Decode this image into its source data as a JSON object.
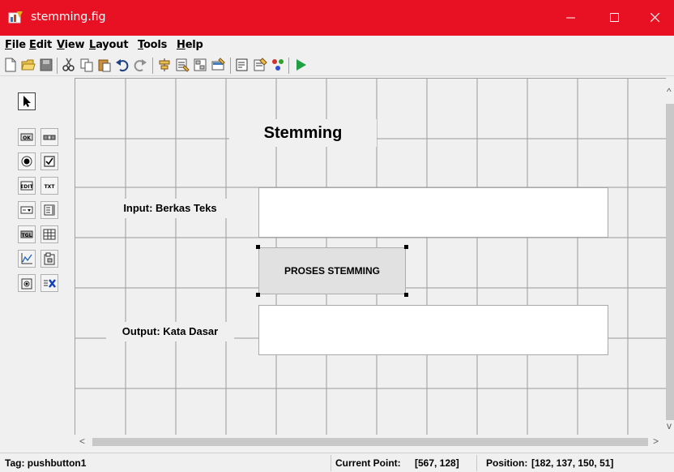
{
  "window": {
    "title": "stemming.fig",
    "accent_color": "#e81123",
    "icons": [
      "app-figure-icon",
      "minimize-icon",
      "maximize-icon",
      "close-icon"
    ]
  },
  "menu": [
    {
      "accel": "F",
      "rest": "ile"
    },
    {
      "accel": "E",
      "rest": "dit"
    },
    {
      "accel": "V",
      "rest": "iew"
    },
    {
      "accel": "L",
      "rest": "ayout"
    },
    {
      "accel": "T",
      "rest": "ools"
    },
    {
      "accel": "H",
      "rest": "elp"
    }
  ],
  "toolbar_icons": [
    "new-icon",
    "open-icon",
    "save-icon",
    "cut-icon",
    "copy-icon",
    "paste-icon",
    "undo-icon",
    "redo-icon",
    "align-icon",
    "menu-editor-icon",
    "tab-order-icon",
    "toolbar-editor-icon",
    "editor-icon",
    "property-inspector-icon",
    "object-browser-icon",
    "run-icon"
  ],
  "palette_icons": [
    "select-arrow-icon",
    "push-button-icon",
    "slider-icon",
    "radio-button-icon",
    "checkbox-icon",
    "edit-text-icon",
    "static-text-icon",
    "popup-menu-icon",
    "listbox-icon",
    "toggle-button-icon",
    "table-icon",
    "axes-icon",
    "panel-icon",
    "button-group-icon",
    "activex-icon"
  ],
  "figure": {
    "heading": "Stemming",
    "input_label": "Input: Berkas Teks",
    "button_label": "PROSES STEMMING",
    "output_label": "Output: Kata Dasar",
    "input_value": "",
    "output_value": ""
  },
  "status": {
    "tag": "Tag: pushbutton1",
    "current_point_label": "Current Point:",
    "current_point_value": "[567, 128]",
    "position_label": "Position:",
    "position_value": "[182, 137, 150, 51]"
  },
  "scroll": {
    "left_arrow": "<",
    "right_arrow": ">",
    "up_arrow": "^",
    "down_arrow": "v"
  }
}
